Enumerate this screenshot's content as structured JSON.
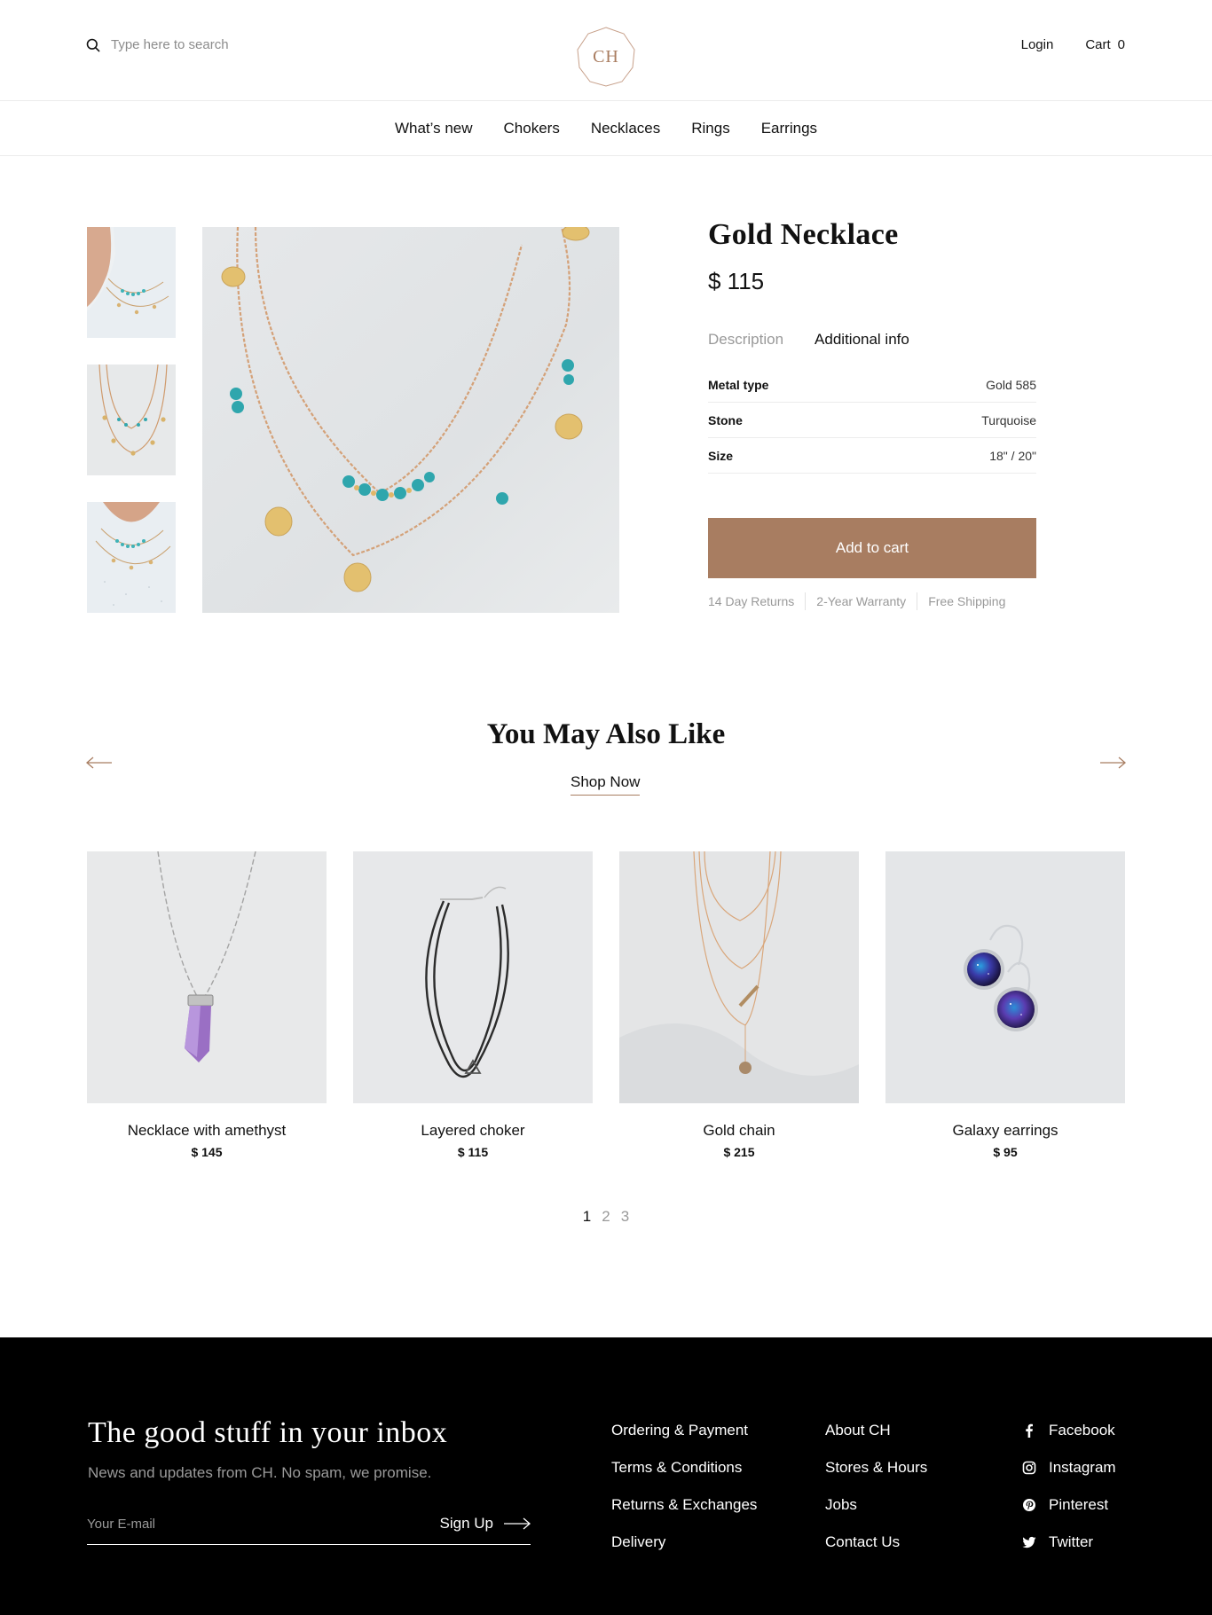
{
  "header": {
    "search_placeholder": "Type here to search",
    "logo_text": "CH",
    "login_label": "Login",
    "cart_label": "Cart",
    "cart_count": "0"
  },
  "nav": {
    "items": [
      "What’s new",
      "Chokers",
      "Necklaces",
      "Rings",
      "Earrings"
    ]
  },
  "product": {
    "title": "Gold Necklace",
    "price": "$ 115",
    "tabs": [
      {
        "label": "Description",
        "active": false
      },
      {
        "label": "Additional info",
        "active": true
      }
    ],
    "specs": [
      {
        "label": "Metal type",
        "value": "Gold 585"
      },
      {
        "label": "Stone",
        "value": "Turquoise"
      },
      {
        "label": "Size",
        "value": "18\" / 20\""
      }
    ],
    "add_to_cart_label": "Add to cart",
    "perks": [
      "14 Day Returns",
      "2-Year Warranty",
      "Free Shipping"
    ]
  },
  "also_like": {
    "title": "You May Also Like",
    "shop_now_label": "Shop Now",
    "products": [
      {
        "name": "Necklace with amethyst",
        "price": "$ 145"
      },
      {
        "name": "Layered choker",
        "price": "$ 115"
      },
      {
        "name": "Gold chain",
        "price": "$ 215"
      },
      {
        "name": "Galaxy earrings",
        "price": "$ 95"
      }
    ],
    "pages": [
      "1",
      "2",
      "3"
    ],
    "active_page": "1"
  },
  "footer": {
    "newsletter_title": "The good stuff in your inbox",
    "newsletter_subtitle": "News and updates from CH. No spam, we promise.",
    "email_placeholder": "Your E-mail",
    "signup_label": "Sign Up",
    "col1": [
      "Ordering & Payment",
      "Terms & Conditions",
      "Returns & Exchanges",
      "Delivery"
    ],
    "col2": [
      "About CH",
      "Stores & Hours",
      "Jobs",
      "Contact Us"
    ],
    "social": [
      "Facebook",
      "Instagram",
      "Pinterest",
      "Twitter"
    ]
  },
  "colors": {
    "accent": "#a87d61",
    "text": "#111111",
    "muted": "#999999",
    "footer_bg": "#000000"
  }
}
